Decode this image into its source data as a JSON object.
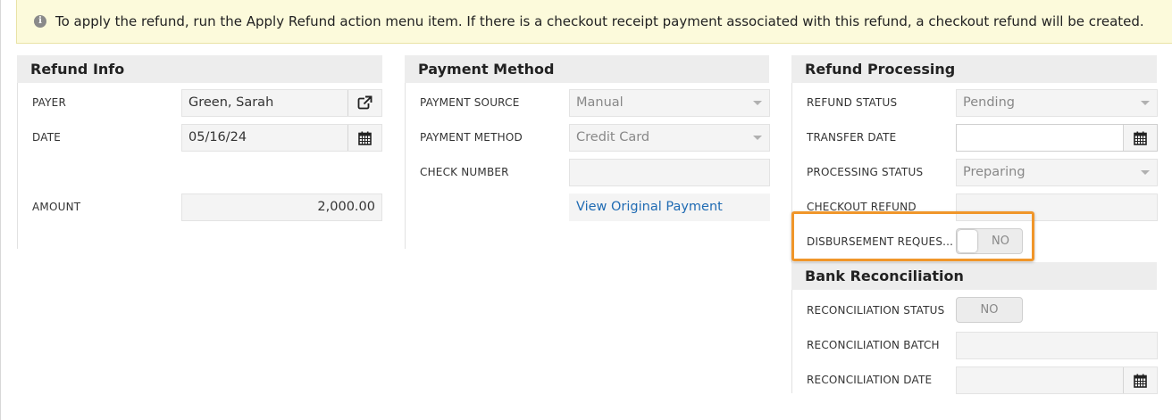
{
  "banner": {
    "icon": "info-icon",
    "text": "To apply the refund, run the Apply Refund action menu item. If there is a checkout receipt payment associated with this refund, a checkout refund will be created."
  },
  "refund_info": {
    "title": "Refund Info",
    "payer_label": "PAYER",
    "payer_value": "Green, Sarah",
    "date_label": "DATE",
    "date_value": "05/16/24",
    "amount_label": "AMOUNT",
    "amount_value": "2,000.00"
  },
  "payment_method": {
    "title": "Payment Method",
    "source_label": "PAYMENT SOURCE",
    "source_value": "Manual",
    "method_label": "PAYMENT METHOD",
    "method_value": "Credit Card",
    "check_label": "CHECK NUMBER",
    "check_value": "",
    "view_link": "View Original Payment"
  },
  "refund_processing": {
    "title": "Refund Processing",
    "status_label": "REFUND STATUS",
    "status_value": "Pending",
    "transfer_label": "TRANSFER DATE",
    "transfer_value": "",
    "processing_label": "PROCESSING STATUS",
    "processing_value": "Preparing",
    "checkout_label": "CHECKOUT REFUND",
    "checkout_value": "",
    "disbursement_label": "DISBURSEMENT REQUES...",
    "disbursement_value": "NO"
  },
  "bank_reconciliation": {
    "title": "Bank Reconciliation",
    "status_label": "RECONCILIATION STATUS",
    "status_value": "NO",
    "batch_label": "RECONCILIATION BATCH",
    "batch_value": "",
    "date_label": "RECONCILIATION DATE",
    "date_value": ""
  },
  "colors": {
    "highlight": "#f0962a",
    "link": "#1f6bb3",
    "banner_bg": "#fcfadb"
  }
}
